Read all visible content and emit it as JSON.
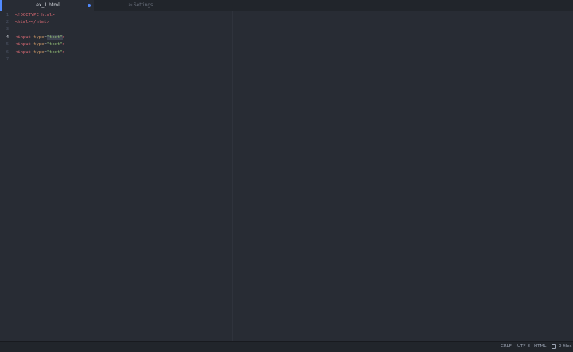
{
  "tabs": [
    {
      "label": "ex_1.html",
      "modified": true
    },
    {
      "label": "Settings",
      "icon": "tools-icon"
    }
  ],
  "editor": {
    "line_numbers": [
      "1",
      "2",
      "3",
      "4",
      "5",
      "6",
      "7"
    ],
    "current_line": "4",
    "lines": [
      {
        "parts": [
          {
            "t": "tag",
            "v": "<!DOCTYPE html>"
          }
        ]
      },
      {
        "parts": [
          {
            "t": "tag",
            "v": "<html></html>"
          }
        ]
      },
      {
        "parts": []
      },
      {
        "parts": [
          {
            "t": "tag",
            "v": "<input"
          },
          {
            "t": "punct",
            "v": " "
          },
          {
            "t": "attr",
            "v": "type"
          },
          {
            "t": "punct",
            "v": "="
          },
          {
            "t": "str",
            "v": "\"text\""
          },
          {
            "t": "tag",
            "v": ">"
          }
        ]
      },
      {
        "parts": [
          {
            "t": "tag",
            "v": "<input"
          },
          {
            "t": "punct",
            "v": " "
          },
          {
            "t": "attr",
            "v": "type"
          },
          {
            "t": "punct",
            "v": "="
          },
          {
            "t": "str",
            "v": "\"text\""
          },
          {
            "t": "tag",
            "v": ">"
          }
        ]
      },
      {
        "parts": [
          {
            "t": "tag",
            "v": "<input"
          },
          {
            "t": "punct",
            "v": " "
          },
          {
            "t": "attr",
            "v": "type"
          },
          {
            "t": "punct",
            "v": "="
          },
          {
            "t": "str",
            "v": "\"text\""
          },
          {
            "t": "tag",
            "v": ">"
          }
        ]
      },
      {
        "parts": []
      }
    ]
  },
  "status": {
    "line_ending": "CRLF",
    "encoding": "UTF-8",
    "grammar": "HTML",
    "files": "0 files"
  },
  "colors": {
    "background": "#282c34",
    "accent": "#528bff",
    "tag": "#e06c75",
    "attribute": "#d19a66",
    "string": "#98c379"
  }
}
